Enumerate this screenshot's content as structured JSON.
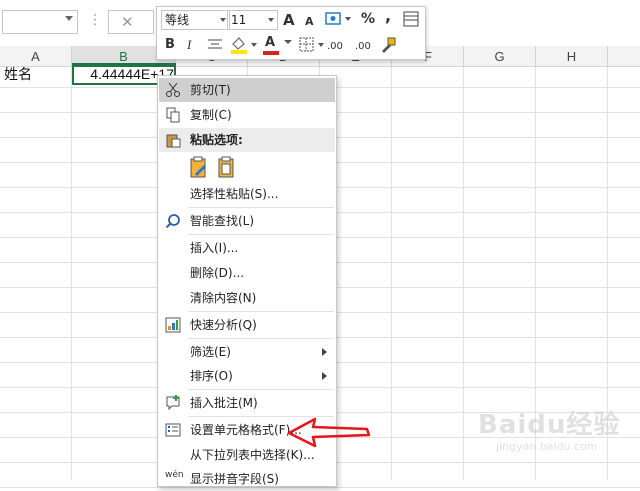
{
  "formula_bar": {
    "cancel_glyph": "✕",
    "dots": "⋮"
  },
  "columns": [
    "A",
    "B",
    "C",
    "D",
    "E",
    "F",
    "G",
    "H"
  ],
  "cells": {
    "A1": "姓名",
    "B1": "4.44444E+17"
  },
  "mini_toolbar": {
    "font_name": "等线",
    "font_size": "11",
    "bold": "B",
    "italic": "I",
    "grow_font": "A",
    "shrink_font": "A",
    "percent": "%",
    "comma": ",",
    "font_color_letter": "A",
    "decimal_increase": ".00",
    "decimal_decrease": ".00",
    "accent_colors": {
      "fill": "#ffe600",
      "font": "#e0201e"
    }
  },
  "context_menu": {
    "items": [
      {
        "label": "剪切(T)",
        "icon": "scissors-icon",
        "highlighted": true
      },
      {
        "label": "复制(C)",
        "icon": "copy-icon"
      },
      {
        "label": "粘贴选项:",
        "icon": "paste-icon",
        "header": true
      },
      {
        "label": "选择性粘贴(S)...",
        "icon": ""
      },
      {
        "label": "智能查找(L)",
        "icon": "smart-lookup-icon"
      },
      {
        "label": "插入(I)...",
        "icon": ""
      },
      {
        "label": "删除(D)...",
        "icon": ""
      },
      {
        "label": "清除内容(N)",
        "icon": ""
      },
      {
        "label": "快速分析(Q)",
        "icon": "quick-analysis-icon"
      },
      {
        "label": "筛选(E)",
        "icon": "",
        "submenu": true
      },
      {
        "label": "排序(O)",
        "icon": "",
        "submenu": true
      },
      {
        "label": "插入批注(M)",
        "icon": "insert-comment-icon"
      },
      {
        "label": "设置单元格格式(F)...",
        "icon": "format-cells-icon"
      },
      {
        "label": "从下拉列表中选择(K)...",
        "icon": ""
      },
      {
        "label": "显示拼音字段(S)",
        "icon": "phonetic-icon",
        "icon_text": "wén"
      }
    ]
  },
  "annotation_color": "#e8141b",
  "watermark": {
    "brand": "Baidu经验",
    "url": "jingyan.baidu.com"
  }
}
